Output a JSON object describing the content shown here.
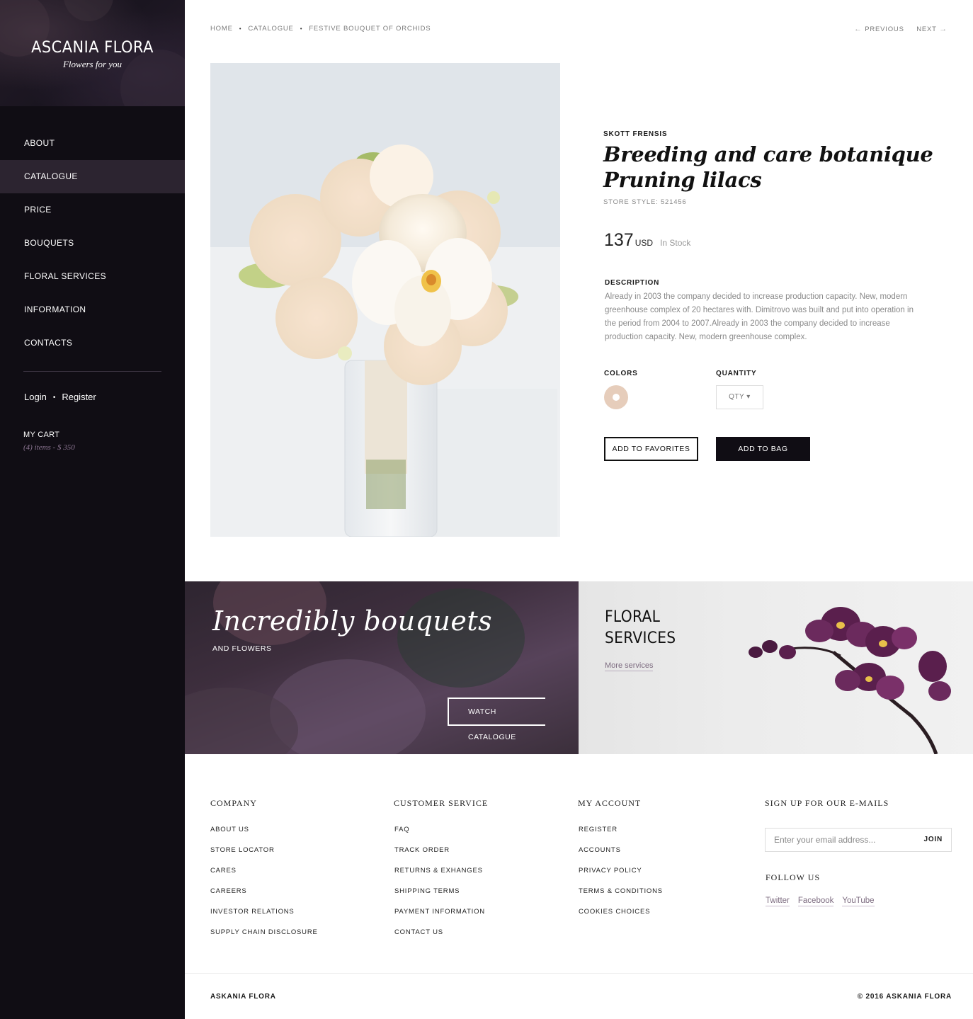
{
  "brand": {
    "title": "ASCANIA FLORA",
    "subtitle": "Flowers for you"
  },
  "nav": {
    "items": [
      "ABOUT",
      "CATALOGUE",
      "PRICE",
      "BOUQUETS",
      "FLORAL SERVICES",
      "INFORMATION",
      "CONTACTS"
    ],
    "active": "CATALOGUE"
  },
  "auth": {
    "login": "Login",
    "separator": "•",
    "register": "Register"
  },
  "cart": {
    "title": "MY CART",
    "info": "(4) items - $ 350"
  },
  "breadcrumb": {
    "items": [
      "HOME",
      "CATALOGUE",
      "FESTIVE BOUQUET OF ORCHIDS"
    ],
    "separator": "•"
  },
  "pager": {
    "previous": "PREVIOUS",
    "next": "NEXT",
    "prev_icon": "←",
    "next_icon": "→"
  },
  "product": {
    "maker": "SKOTT FRENSIS",
    "title_line1": "Breeding and care botanique",
    "title_line2": "Pruning lilacs",
    "store_style": "STORE STYLE: 521456",
    "price": "137",
    "currency": "USD",
    "stock": "In Stock",
    "description_heading": "DESCRIPTION",
    "description": "Already in 2003 the company decided to increase production capacity.  New, modern greenhouse complex of 20 hectares with. Dimitrovo was built and put into operation in the period from 2004 to 2007.Already in 2003 the company decided to increase production capacity.  New, modern greenhouse complex.",
    "colors_heading": "COLORS",
    "quantity_heading": "QUANTITY",
    "qty_label": "QTY ▾",
    "swatch_color": "#e6cdbb",
    "add_favorites": "ADD TO FAVORITES",
    "add_bag": "ADD TO BAG"
  },
  "promo": {
    "left_title": "Incredibly  bouquets",
    "left_sub": "AND FLOWERS",
    "left_button": "WATCH CATALOGUE",
    "right_title_line1": "FLORAL",
    "right_title_line2": "SERVICES",
    "right_link": "More services"
  },
  "footer": {
    "company": {
      "heading": "COMPANY",
      "items": [
        "ABOUT US",
        "STORE LOCATOR",
        "CARES",
        "CAREERS",
        "INVESTOR RELATIONS",
        "SUPPLY CHAIN DISCLOSURE"
      ]
    },
    "customer": {
      "heading": "CUSTOMER SERVICE",
      "items": [
        "FAQ",
        "TRACK ORDER",
        "RETURNS & EXHANGES",
        "SHIPPING TERMS",
        "PAYMENT INFORMATION",
        "CONTACT US"
      ]
    },
    "account": {
      "heading": "MY ACCOUNT",
      "items": [
        "REGISTER",
        "ACCOUNTS",
        "PRIVACY POLICY",
        "TERMS & CONDITIONS",
        "COOKIES CHOICES"
      ]
    },
    "signup": {
      "heading": "SIGN UP FOR OUR E-MAILS",
      "placeholder": "Enter your email address...",
      "join": "JOIN"
    },
    "follow": {
      "heading": "FOLLOW US",
      "links": [
        "Twitter",
        "Facebook",
        "YouTube"
      ]
    },
    "copyright_left": "ASKANIA FLORA",
    "copyright_right": "© 2016 ASKANIA FLORA"
  },
  "colors": {
    "sidebar_bg": "#100d14",
    "active_nav": "#2c2430",
    "accent": "#7d6c80",
    "dark_button": "#100d14"
  }
}
